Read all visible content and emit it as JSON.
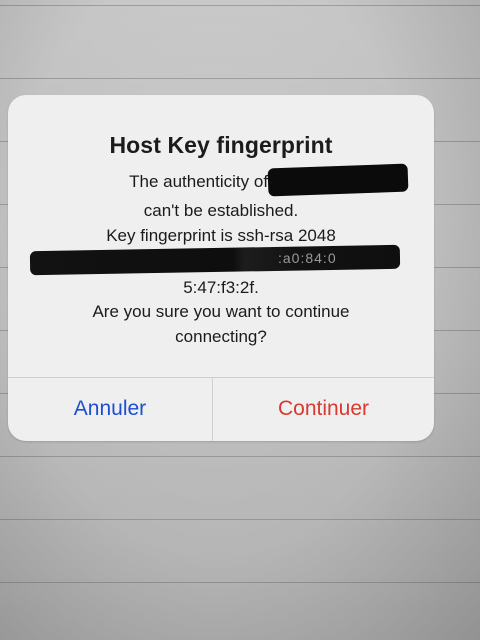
{
  "dialog": {
    "title": "Host Key fingerprint",
    "message_lines": [
      "The authenticity of host '",
      "can't be established.",
      "Key fingerprint is ssh-rsa 2048",
      "5:47:f3:2f.",
      "Are you sure you want to continue",
      "connecting?"
    ],
    "partial_fingerprint_visible": ":a0:84:0",
    "buttons": {
      "cancel_label": "Annuler",
      "continue_label": "Continuer"
    },
    "colors": {
      "cancel": "#1c4fd1",
      "continue": "#d83a2f",
      "dialog_bg": "#efefef"
    }
  }
}
